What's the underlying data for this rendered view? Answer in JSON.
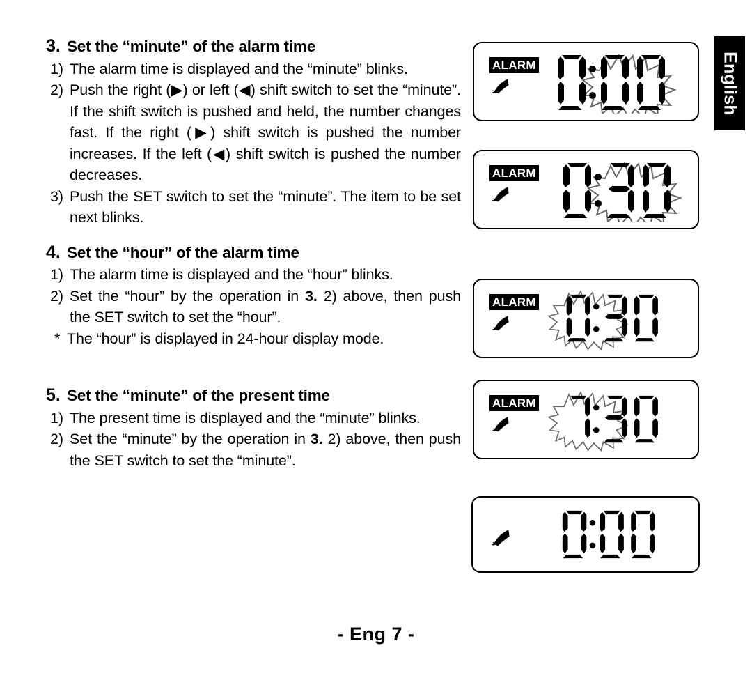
{
  "language_tab": {
    "label": "English"
  },
  "footer": {
    "page_label": "- Eng 7 -"
  },
  "sections": [
    {
      "number": "3.",
      "title": "Set the “minute” of the alarm time",
      "items": [
        {
          "marker": "1)",
          "text": "The alarm time is displayed and the “minute” blinks."
        },
        {
          "marker": "2)",
          "text": "Push the right (▶) or left (◀) shift switch to set the “minute”. If the shift switch is pushed and held, the number changes fast. If the right (▶) shift switch is pushed the number increases. If the left (◀) shift switch is pushed the number decreases."
        },
        {
          "marker": "3)",
          "text": "Push the SET switch to set the “minute”. The item to be set next blinks."
        }
      ]
    },
    {
      "number": "4.",
      "title": "Set the “hour” of the alarm time",
      "items": [
        {
          "marker": "1)",
          "text": "The alarm time is displayed and the “hour” blinks."
        },
        {
          "marker": "2)",
          "text": "Set the “hour” by the operation in 3. 2) above, then push the SET switch to set the “hour”."
        },
        {
          "marker": "*",
          "text": "The “hour” is displayed in 24-hour display mode."
        }
      ]
    },
    {
      "number": "5.",
      "title": "Set the “minute” of the present time",
      "items": [
        {
          "marker": "1)",
          "text": "The present time is displayed and the “minute” blinks."
        },
        {
          "marker": "2)",
          "text": "Set the “minute” by the operation in 3. 2) above, then push the SET switch to set the “minute”."
        }
      ]
    }
  ],
  "lcd_panels": [
    {
      "id": "panel-alarm-0-00-minute-blink",
      "alarm_label": "ALARM",
      "show_alarm_label": true,
      "bell_icon": "bell-icon",
      "time": "0:00",
      "hour": "0",
      "minute": "00",
      "blinking_part": "minute",
      "blink_indicator": "starburst-outline"
    },
    {
      "id": "panel-alarm-0-30-minute-blink",
      "alarm_label": "ALARM",
      "show_alarm_label": true,
      "bell_icon": "bell-icon",
      "time": "0:30",
      "hour": "0",
      "minute": "30",
      "blinking_part": "minute",
      "blink_indicator": "starburst-outline"
    },
    {
      "id": "panel-alarm-0-30-hour-blink",
      "alarm_label": "ALARM",
      "show_alarm_label": true,
      "bell_icon": "bell-icon",
      "time": "0:30",
      "hour": "0",
      "minute": "30",
      "blinking_part": "hour",
      "blink_indicator": "starburst-outline"
    },
    {
      "id": "panel-alarm-7-30-hour-blink",
      "alarm_label": "ALARM",
      "show_alarm_label": true,
      "bell_icon": "bell-icon",
      "time": "7:30",
      "hour": "7",
      "minute": "30",
      "blinking_part": "hour",
      "blink_indicator": "starburst-outline"
    },
    {
      "id": "panel-present-0-00",
      "alarm_label": "",
      "show_alarm_label": false,
      "bell_icon": "bell-icon",
      "time": "0:00",
      "hour": "0",
      "minute": "00",
      "blinking_part": "none",
      "blink_indicator": "none"
    }
  ],
  "colors": {
    "ink": "#000000",
    "paper": "#ffffff",
    "starburst_outline": "#6a6a6a"
  }
}
